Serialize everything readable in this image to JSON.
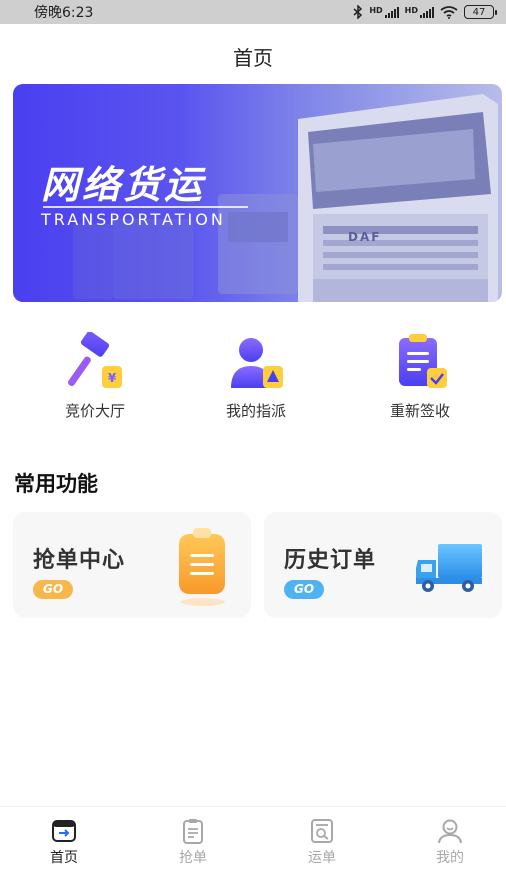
{
  "status_bar": {
    "time": "傍晚6:23",
    "signal_label_1": "HD",
    "signal_label_2": "HD",
    "battery": "47"
  },
  "header": {
    "title": "首页"
  },
  "banner": {
    "title": "网络货运",
    "subtitle": "TRANSPORTATION",
    "truck_brand": "DAF",
    "colors": {
      "gradient_start": "#4a3ff0",
      "gradient_end": "#b7bde8"
    }
  },
  "quick_actions": [
    {
      "label": "竞价大厅",
      "icon": "gavel-icon"
    },
    {
      "label": "我的指派",
      "icon": "assign-person-icon"
    },
    {
      "label": "重新签收",
      "icon": "sign-clipboard-icon"
    }
  ],
  "common": {
    "title": "常用功能",
    "cards": [
      {
        "title": "抢单中心",
        "badge": "GO",
        "badge_color": "#f7b74b",
        "icon": "clipboard-icon"
      },
      {
        "title": "历史订单",
        "badge": "GO",
        "badge_color": "#4fb2f3",
        "icon": "truck-icon"
      }
    ]
  },
  "tab_bar": {
    "active_color": "#222222",
    "inactive_color": "#a8a8a8",
    "tabs": [
      {
        "label": "首页",
        "icon": "home-icon",
        "active": true
      },
      {
        "label": "抢单",
        "icon": "order-grab-icon",
        "active": false
      },
      {
        "label": "运单",
        "icon": "waybill-search-icon",
        "active": false
      },
      {
        "label": "我的",
        "icon": "profile-icon",
        "active": false
      }
    ]
  }
}
